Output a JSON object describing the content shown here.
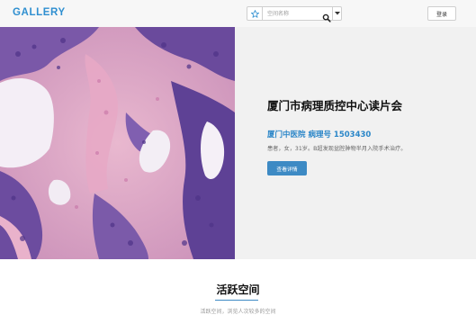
{
  "header": {
    "logo": "GALLERY",
    "search": {
      "placeholder": "空间名称"
    },
    "login_label": "登录"
  },
  "hero": {
    "title": "厦门市病理质控中心读片会",
    "subtitle": "厦门中医院 病理号 1503430",
    "description": "患者，女，31岁。B超发现盆腔肿物半月入院手术治疗。",
    "button_label": "查看详情"
  },
  "section": {
    "title": "活跃空间",
    "description": "活跃空间，浏览人次较多的空间"
  },
  "colors": {
    "brand": "#2f8fd0",
    "accent_button": "#3d8ac4",
    "stain_pink": "#d7a6c4",
    "stain_purple": "#5b3f93"
  },
  "icons": {
    "favorite": "star-icon",
    "search": "search-icon",
    "dropdown": "caret-down-icon"
  }
}
